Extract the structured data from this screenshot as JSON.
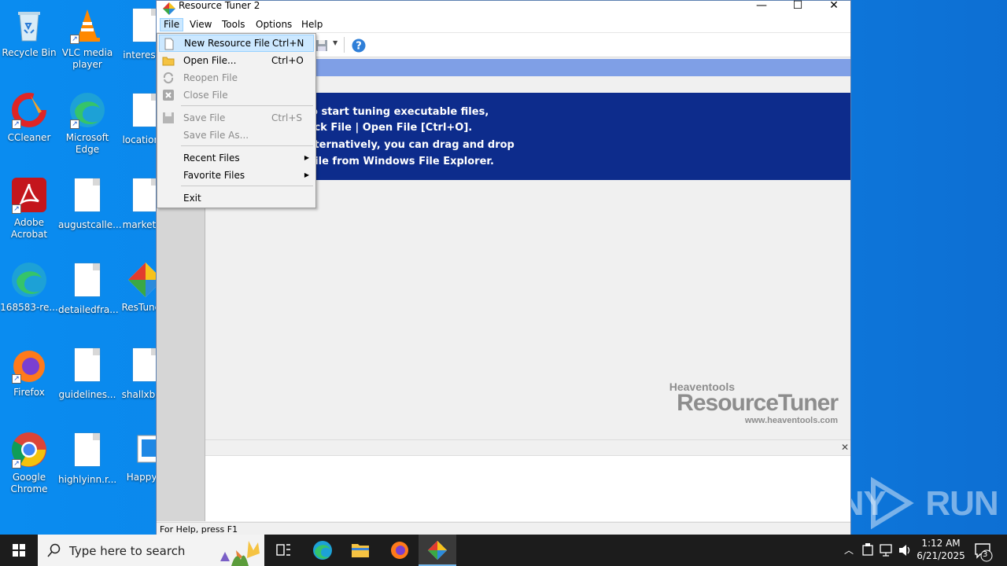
{
  "desktop": {
    "icons": [
      {
        "label": "Recycle Bin"
      },
      {
        "label": "VLC media player"
      },
      {
        "label": "interest..."
      },
      {
        "label": "CCleaner"
      },
      {
        "label": "Microsoft Edge"
      },
      {
        "label": "location..."
      },
      {
        "label": "Adobe Acrobat"
      },
      {
        "label": "augustcalle..."
      },
      {
        "label": "markett..."
      },
      {
        "label": "168583-re..."
      },
      {
        "label": "detailedfra..."
      },
      {
        "label": "ResTune..."
      },
      {
        "label": "Firefox"
      },
      {
        "label": "guidelines..."
      },
      {
        "label": "shallxbc..."
      },
      {
        "label": "Google Chrome"
      },
      {
        "label": "highlyinn.r..."
      },
      {
        "label": "Happy..."
      }
    ],
    "watermark": "ANY RUN"
  },
  "window": {
    "title": "Resource Tuner 2",
    "controls": {
      "minimize": "—",
      "maximize": "☐",
      "close": "✕"
    },
    "menu": {
      "file": "File",
      "view": "View",
      "tools": "Tools",
      "options": "Options",
      "help": "Help"
    },
    "banner_lines": [
      "o start tuning executable files,",
      "ick File | Open File [Ctrl+O].",
      "lternatively, you can drag and drop",
      "file from Windows File Explorer."
    ],
    "logo": {
      "small": "Heaventools",
      "big": "ResourceTuner",
      "url": "www.heaventools.com"
    },
    "output_close": "✕",
    "status": "For Help, press F1"
  },
  "file_menu": {
    "items": [
      {
        "label": "New Resource File",
        "shortcut": "Ctrl+N"
      },
      {
        "label": "Open File...",
        "shortcut": "Ctrl+O"
      },
      {
        "label": "Reopen File",
        "shortcut": ""
      },
      {
        "label": "Close File",
        "shortcut": ""
      },
      {
        "label": "Save File",
        "shortcut": "Ctrl+S"
      },
      {
        "label": "Save File As...",
        "shortcut": ""
      },
      {
        "label": "Recent Files",
        "shortcut": ""
      },
      {
        "label": "Favorite Files",
        "shortcut": ""
      },
      {
        "label": "Exit",
        "shortcut": ""
      }
    ]
  },
  "taskbar": {
    "search_placeholder": "Type here to search",
    "time": "1:12 AM",
    "date": "6/21/2025",
    "notification_count": "3"
  },
  "colors": {
    "banner": "#0d2c8c",
    "menu_highlight": "#cce8ff",
    "taskbar": "#1c1c1c"
  }
}
